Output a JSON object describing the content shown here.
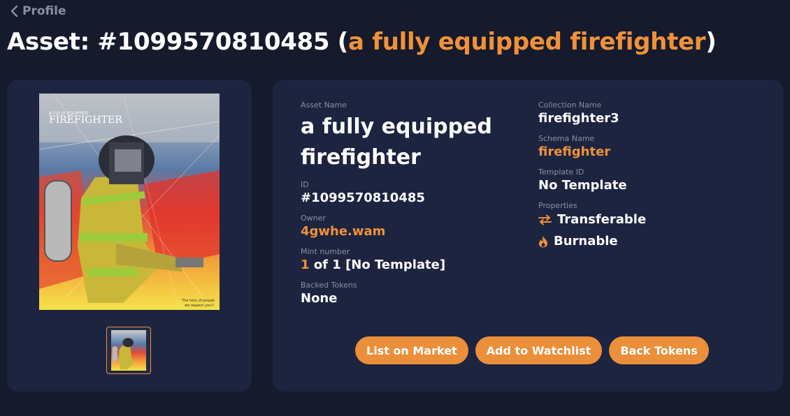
{
  "nav": {
    "back_label": "Profile"
  },
  "header": {
    "title_prefix": "Asset: #1099570810485 (",
    "title_name": "a fully equipped firefighter",
    "title_suffix": ")"
  },
  "image": {
    "poster_small_text": "A FULLY EQUIPPED",
    "poster_title": "FIREFIGHTER",
    "poster_caption_1": "The hero of people",
    "poster_caption_2": "we respect you!!"
  },
  "details": {
    "asset_name": {
      "label": "Asset Name",
      "value": "a fully equipped firefighter"
    },
    "id": {
      "label": "ID",
      "value": "#1099570810485"
    },
    "owner": {
      "label": "Owner",
      "value": "4gwhe.wam"
    },
    "mint": {
      "label": "Mint number",
      "number": "1",
      "rest": "of 1 [No Template]"
    },
    "backed": {
      "label": "Backed Tokens",
      "value": "None"
    },
    "collection": {
      "label": "Collection Name",
      "value": "firefighter3"
    },
    "schema": {
      "label": "Schema Name",
      "value": "firefighter"
    },
    "template": {
      "label": "Template ID",
      "value": "No Template"
    },
    "properties": {
      "label": "Properties",
      "items": [
        {
          "label": "Transferable",
          "icon": "transfer-arrows-icon"
        },
        {
          "label": "Burnable",
          "icon": "flame-icon"
        }
      ]
    }
  },
  "actions": {
    "list_label": "List on Market",
    "watch_label": "Add to Watchlist",
    "back_tokens_label": "Back Tokens"
  },
  "colors": {
    "background": "#151a2c",
    "card": "#1d2440",
    "accent": "#f0913a",
    "muted": "#8b8fa3"
  }
}
